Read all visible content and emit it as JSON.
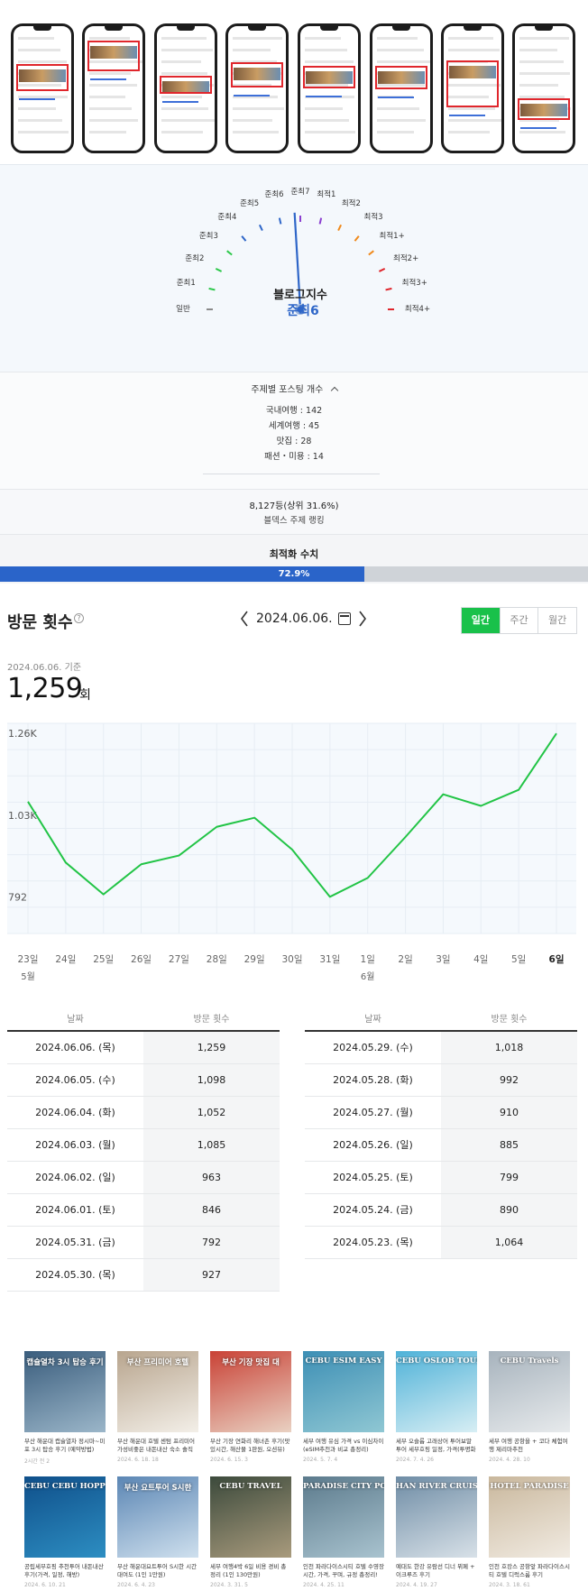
{
  "gauge": {
    "title": "블로그지수",
    "value": "준최6",
    "labels": [
      "일반",
      "준최1",
      "준최2",
      "준최3",
      "준최4",
      "준최5",
      "준최6",
      "준최7",
      "최적1",
      "최적2",
      "최적3",
      "최적1+",
      "최적2+",
      "최적3+",
      "최적4+"
    ],
    "tick_colors": [
      "#8a8a8a",
      "#2cc84a",
      "#2cc84a",
      "#2cc84a",
      "#2e66c8",
      "#2e66c8",
      "#2e66c8",
      "#8b3fd0",
      "#8b3fd0",
      "#f08a1c",
      "#f08a1c",
      "#f08a1c",
      "#e0262c",
      "#e0262c",
      "#e0262c"
    ],
    "active_index": 6,
    "needle_color": "#2e66c8"
  },
  "topics": {
    "title": "주제별 포스팅 개수",
    "items": [
      "국내여행 : 142",
      "세계여행 : 45",
      "맛집 : 28",
      "패션・미용 : 14"
    ]
  },
  "rank": {
    "value": "8,127등(상위 31.6%)",
    "label": "블덱스 주제 랭킹"
  },
  "optimization": {
    "title": "최적화 수치",
    "value": "72.9%",
    "percent": 72.9
  },
  "visits": {
    "title": "방문 횟수",
    "help": "?",
    "date": "2024.06.06.",
    "tabs": [
      "일간",
      "주간",
      "월간"
    ],
    "active_tab": "일간",
    "basis": "2024.06.06. 기준",
    "total": "1,259",
    "unit": "회"
  },
  "chart_data": {
    "type": "line",
    "x": [
      "23일",
      "24일",
      "25일",
      "26일",
      "27일",
      "28일",
      "29일",
      "30일",
      "31일",
      "1일",
      "2일",
      "3일",
      "4일",
      "5일",
      "6일"
    ],
    "month_labels": [
      {
        "index": 0,
        "text": "5월"
      },
      {
        "index": 9,
        "text": "6월"
      }
    ],
    "series": [
      {
        "values": [
          1064,
          890,
          799,
          885,
          910,
          992,
          1018,
          927,
          792,
          846,
          963,
          1085,
          1052,
          1098,
          1259
        ]
      }
    ],
    "y_ticks": [
      "792",
      "1.03K",
      "1.26K"
    ],
    "y_tick_values": [
      792,
      1025,
      1259
    ],
    "ylim": [
      700,
      1275
    ],
    "color": "#22c446",
    "grid": true,
    "highlight_last": true
  },
  "table": {
    "headers": [
      "날짜",
      "방문 횟수"
    ],
    "left": [
      {
        "date": "2024.06.06. (목)",
        "count": "1,259"
      },
      {
        "date": "2024.06.05. (수)",
        "count": "1,098"
      },
      {
        "date": "2024.06.04. (화)",
        "count": "1,052"
      },
      {
        "date": "2024.06.03. (월)",
        "count": "1,085"
      },
      {
        "date": "2024.06.02. (일)",
        "count": "963"
      },
      {
        "date": "2024.06.01. (토)",
        "count": "846"
      },
      {
        "date": "2024.05.31. (금)",
        "count": "792"
      },
      {
        "date": "2024.05.30. (목)",
        "count": "927"
      }
    ],
    "right": [
      {
        "date": "2024.05.29. (수)",
        "count": "1,018"
      },
      {
        "date": "2024.05.28. (화)",
        "count": "992"
      },
      {
        "date": "2024.05.27. (월)",
        "count": "910"
      },
      {
        "date": "2024.05.26. (일)",
        "count": "885"
      },
      {
        "date": "2024.05.25. (토)",
        "count": "799"
      },
      {
        "date": "2024.05.24. (금)",
        "count": "890"
      },
      {
        "date": "2024.05.23. (목)",
        "count": "1,064"
      }
    ]
  },
  "posts": [
    {
      "caption": "캡슐열차 3시 탑승 후기",
      "title": "부산 해운대 캡슐열차 정시마~미포 3시 탑승 후기 (예약방법)",
      "meta": "2시간 전  2",
      "colors": [
        "#3a5d7d",
        "#9bb6c9"
      ]
    },
    {
      "caption": "부산 프리미어 호텔",
      "title": "부산 해운대 호텔 센텀 프리미어 가성비좋은 내돈내산 숙소 솔직 후기",
      "meta": "2024. 6. 18.  18",
      "colors": [
        "#b8a58e",
        "#f3efe8"
      ]
    },
    {
      "caption": "부산 기장 맛집 대",
      "title": "부산 기장 연화리 해녀촌 후기(맛있시간, 해산물 1판원, 오션뷰)",
      "meta": "2024. 6. 15.  3",
      "colors": [
        "#c94236",
        "#e9d1c2"
      ]
    },
    {
      "caption": "CEBU ESIM EASY",
      "title": "세부 여행 유심 가격 vs 이심차이 (eSIM추천과 비교 총정리)",
      "meta": "2024. 5. 7.  4",
      "colors": [
        "#3d8fb5",
        "#8fc7d3"
      ]
    },
    {
      "caption": "CEBU OSLOB TOUR",
      "title": "세부 오슬롭 고래상어 투어보말 투어 세부호핑 일정, 가격(투명화 체험)",
      "meta": "2024. 7. 4.  26",
      "colors": [
        "#4fb2d8",
        "#d7eef4"
      ]
    },
    {
      "caption": "CEBU Travels",
      "title": "세부 여행 공항을 + 코다 체험여행 제리마추천",
      "meta": "2024. 4. 28.  10",
      "colors": [
        "#a7b3bd",
        "#e7eaec"
      ]
    },
    {
      "caption": "CEBU CEBU HOPPING",
      "title": "공립세부호핑 추천투어 내돈내산 후기(가격, 일정, 해방)",
      "meta": "2024. 6. 10.  21",
      "colors": [
        "#0f4f8a",
        "#2d8ec2"
      ]
    },
    {
      "caption": "부산 요트투어 S시한",
      "title": "부산 해운대요트투어 S시한 시간 대여도 (1인 1만원)",
      "meta": "2024. 6. 4.  23",
      "colors": [
        "#5b86b4",
        "#cfe0ee"
      ]
    },
    {
      "caption": "CEBU TRAVEL",
      "title": "세부 여행4박 6일 비용 경비 총정리 (1인 130만원)",
      "meta": "2024. 3. 31.  5",
      "colors": [
        "#3c4a3c",
        "#a99b7d"
      ]
    },
    {
      "caption": "PARADISE CITY POOL",
      "title": "인천 파라다이스시티 호텔 수영장 시간, 가격, 꾸며, 규정 총정리!",
      "meta": "2024. 4. 25.  11",
      "colors": [
        "#5b7a8c",
        "#a9c3cf"
      ]
    },
    {
      "caption": "HAN RIVER CRUISE",
      "title": "예대도 한강 유람선 디너 뷔페 + 이크루즈 후기",
      "meta": "2024. 4. 19.  27",
      "colors": [
        "#6e8ca5",
        "#d8e1e8"
      ]
    },
    {
      "caption": "HOTEL PARADISE",
      "title": "인천 호캉스 공항앞 파라다이스시티 호텔 디럭스룸 후기",
      "meta": "2024. 3. 18.  61",
      "colors": [
        "#c9b79c",
        "#f1ebe2"
      ]
    }
  ]
}
